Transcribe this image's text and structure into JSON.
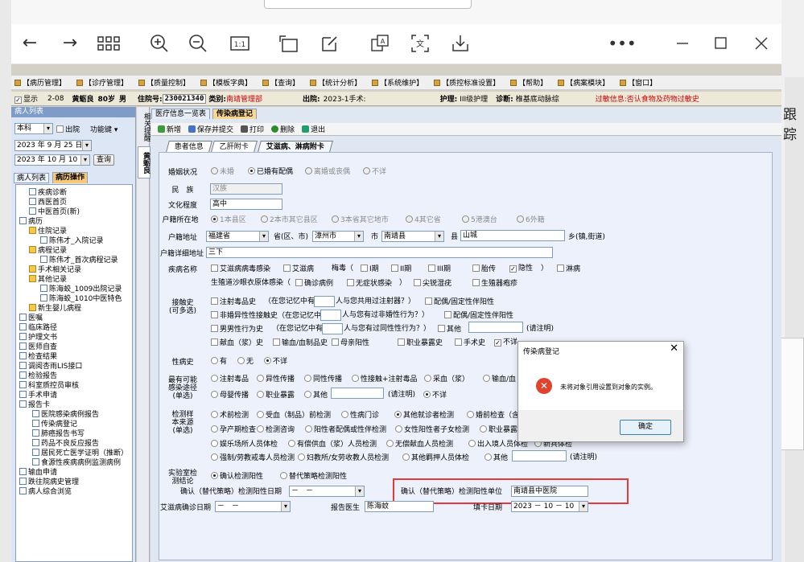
{
  "viewer": {
    "icons": [
      "back-icon",
      "forward-icon",
      "grid-icon",
      "zoom-in-icon",
      "zoom-out-icon",
      "fit-icon",
      "rotate-icon",
      "edit-icon",
      "translate-icon",
      "ocr-icon",
      "download-icon",
      "more-icon",
      "minimize-icon",
      "maximize-icon",
      "close-icon"
    ]
  },
  "menu": [
    "【病历管理】",
    "【诊疗管理】",
    "【质量控制】",
    "【模板字典】",
    "【查询】",
    "【统计分析】",
    "【系统维护】",
    "【质控标准设置】",
    "【帮助】",
    "【病案模块】",
    "【窗口】"
  ],
  "info": {
    "show_label": "显示",
    "bed": "2-08",
    "name": "黄蛎良",
    "age": "80岁",
    "sex": "男",
    "admit_no_label": "住院号:",
    "admit_no": "230021340",
    "category_label": "类别:",
    "category": "南靖管理部",
    "discharge_label": "出院:",
    "surgery": "2023-1手术:",
    "nursing_label": "护理:",
    "nursing": "III级护理",
    "diagnosis_label": "诊断:",
    "diagnosis": "椎基底动脉综",
    "allergy": "过敏信息:否认食物及药物过敏史"
  },
  "left_panel": {
    "header": "病人列表",
    "scope": "本科",
    "discharged_label": "出院",
    "function_label": "功能键",
    "date_from": "2023 年 9 月 25 日",
    "date_to": "2023 年 10 月 10",
    "query_button": "查询",
    "tabs": [
      "病人列表",
      "病历操作"
    ],
    "tree": [
      {
        "label": "疾病诊断",
        "lvl": 1,
        "t": "d"
      },
      {
        "label": "西医首页",
        "lvl": 1,
        "t": "d"
      },
      {
        "label": "中医首页(新)",
        "lvl": 1,
        "t": "d"
      },
      {
        "label": "病历",
        "lvl": 0,
        "t": "d"
      },
      {
        "label": "住院记录",
        "lvl": 1,
        "t": "f"
      },
      {
        "label": "陈伟才_入院记录",
        "lvl": 3,
        "t": "d"
      },
      {
        "label": "病程记录",
        "lvl": 1,
        "t": "f"
      },
      {
        "label": "陈伟才_首次病程记录",
        "lvl": 3,
        "t": "d"
      },
      {
        "label": "手术相关记录",
        "lvl": 1,
        "t": "f"
      },
      {
        "label": "其他记录",
        "lvl": 1,
        "t": "f"
      },
      {
        "label": "陈海蛟_1009出院记录",
        "lvl": 3,
        "t": "d"
      },
      {
        "label": "陈海蛟_1010中医特色",
        "lvl": 3,
        "t": "d"
      },
      {
        "label": "新生婴儿病程",
        "lvl": 1,
        "t": "f"
      },
      {
        "label": "医嘱",
        "lvl": 0,
        "t": "d"
      },
      {
        "label": "临床路径",
        "lvl": 0,
        "t": "d"
      },
      {
        "label": "护理文书",
        "lvl": 0,
        "t": "d"
      },
      {
        "label": "医师自查",
        "lvl": 0,
        "t": "d"
      },
      {
        "label": "检查结果",
        "lvl": 0,
        "t": "d"
      },
      {
        "label": "调阅杏雨LIS接口",
        "lvl": 0,
        "t": "d"
      },
      {
        "label": "检验报告",
        "lvl": 0,
        "t": "d"
      },
      {
        "label": "科室质控员审核",
        "lvl": 0,
        "t": "d"
      },
      {
        "label": "手术申请",
        "lvl": 0,
        "t": "d"
      },
      {
        "label": "报告卡",
        "lvl": 0,
        "t": "d"
      },
      {
        "label": "医院感染病例报告",
        "lvl": 2,
        "t": "d"
      },
      {
        "label": "传染病登记",
        "lvl": 2,
        "t": "d"
      },
      {
        "label": "肺癌报告书写",
        "lvl": 2,
        "t": "d"
      },
      {
        "label": "药品不良反应报告",
        "lvl": 2,
        "t": "d"
      },
      {
        "label": "居民死亡医学证明（推断）",
        "lvl": 2,
        "t": "d"
      },
      {
        "label": "食源性疾病病例监测病例",
        "lvl": 2,
        "t": "d"
      },
      {
        "label": "输血申请",
        "lvl": 0,
        "t": "d"
      },
      {
        "label": "跌往院病史管理",
        "lvl": 0,
        "t": "d"
      },
      {
        "label": "病人综合浏览",
        "lvl": 0,
        "t": "d"
      }
    ]
  },
  "vtabs": [
    "相关提醒",
    "黄蛎良"
  ],
  "doc_tabs": [
    "医疗信息一览表",
    "传染病登记"
  ],
  "toolbar": [
    "新增",
    "保存并提交",
    "打印",
    "删除",
    "退出"
  ],
  "sub_tabs": [
    "患者信息",
    "乙肝附卡",
    "艾滋病、淋病附卡"
  ],
  "form": {
    "marriage_label": "婚姻状况",
    "marriage_opts": [
      "未婚",
      "已婚有配偶",
      "离婚或丧偶",
      "不详"
    ],
    "ethnic_label": "民　族",
    "ethnic": "汉族",
    "edu_label": "文化程度",
    "edu": "高中",
    "residence_label": "户籍所在地",
    "residence_opts": [
      "1本县区",
      "2本市其它县区",
      "3本省其它地市",
      "4其它省",
      "5港澳台",
      "6外籍"
    ],
    "addr_label": "户籍地址",
    "province": "福建省",
    "province_unit": "省(区、市)",
    "city": "漳州市",
    "city_unit": "市",
    "county": "南靖县",
    "county_unit": "县",
    "town": "山城",
    "town_unit": "乡(镇,街道)",
    "addr_detail_label": "户籍详细地址",
    "addr_detail": "三下",
    "disease_label": "疾病名称",
    "disease_opts": [
      "艾滋病病毒感染",
      "艾滋病",
      "梅毒（",
      "I期",
      "II期",
      "III期",
      "胎传",
      "隐性",
      "）",
      "淋病"
    ],
    "disease_opts2": [
      "生殖道沙眼衣原体感染（",
      "确诊病例",
      "无症状感染",
      "）",
      "尖锐湿疣",
      "生殖器疱疹"
    ],
    "contact_label": "接触史\n(可多选)",
    "contact1": "注射毒品史",
    "contact1_mid": "（在您记忆中有",
    "contact1_end": "人与您共用过注射器？）",
    "contact1_right": "配偶/固定性伴阳性",
    "contact2": "非婚异性性接触史（在您记忆中有",
    "contact2_end": "人与您有过非婚性行为？）",
    "contact2_right": "配偶/固定性伴阳性",
    "contact3": "男男性行为史",
    "contact3_mid": "（在您记忆中有",
    "contact3_end": "人与您有过同性性行为？）",
    "contact3_other": "其他",
    "contact3_note": "(请注明)",
    "contact4": [
      "献血（浆）史",
      "输血/血制品史",
      "母亲阳性",
      "职业暴露史",
      "手术史",
      "不详"
    ],
    "std_label": "性病史",
    "std_opts": [
      "有",
      "无",
      "不详"
    ],
    "route_label": "最有可能\n感染途径\n(单选)",
    "route_opts": [
      "注射毒品",
      "异性传播",
      "同性传播",
      "性接触+注射毒品",
      "采血（浆）",
      "输血/血"
    ],
    "route_opts2": [
      "母婴传播",
      "职业暴露",
      "其他"
    ],
    "route_note": "(请注明)",
    "route_unknown": "不详",
    "source_label": "检测样\n本来源\n(单选)",
    "source_row1": [
      "术前检测",
      "受血（制品）前检测",
      "性病门诊",
      "其他就诊者检测",
      "婚前检查（含"
    ],
    "source_row2": [
      "孕产期检查",
      "检测咨询",
      "阳性者配偶或性伴检测",
      "女性阳性者子女检测",
      "职业暴露"
    ],
    "source_row3": [
      "娱乐场所人员体检",
      "有偿供血（浆）人员检测",
      "无偿献血人员检测",
      "出入境人员体检",
      "新兵体检"
    ],
    "source_row4": [
      "强制/劳教戒毒人员检测",
      "妇教所/女劳收教人员检测",
      "其他羁押人员体检",
      "其他"
    ],
    "source_note": "(请注明)",
    "lab_label": "实验室检\n测结论",
    "lab_opts": [
      "确认检测阳性",
      "替代策略检测阳性"
    ],
    "confirm_date_label": "确认（替代策略）检测阳性日期",
    "confirm_date": "－　－",
    "confirm_unit_label": "确认（替代策略）检测阳性单位",
    "confirm_unit": "南靖县中医院",
    "aids_date_label": "艾滋病确诊日期",
    "aids_date": "－　－",
    "reporter_label": "报告医生",
    "reporter": "陈海蚊",
    "fill_date_label": "填卡日期",
    "fill_date": "2023 － 10 － 10"
  },
  "dialog": {
    "title": "传染病登记",
    "message": "未将对象引用设置到对象的实例。",
    "ok": "确定"
  },
  "desktop": {
    "right_text": "跟踪"
  }
}
